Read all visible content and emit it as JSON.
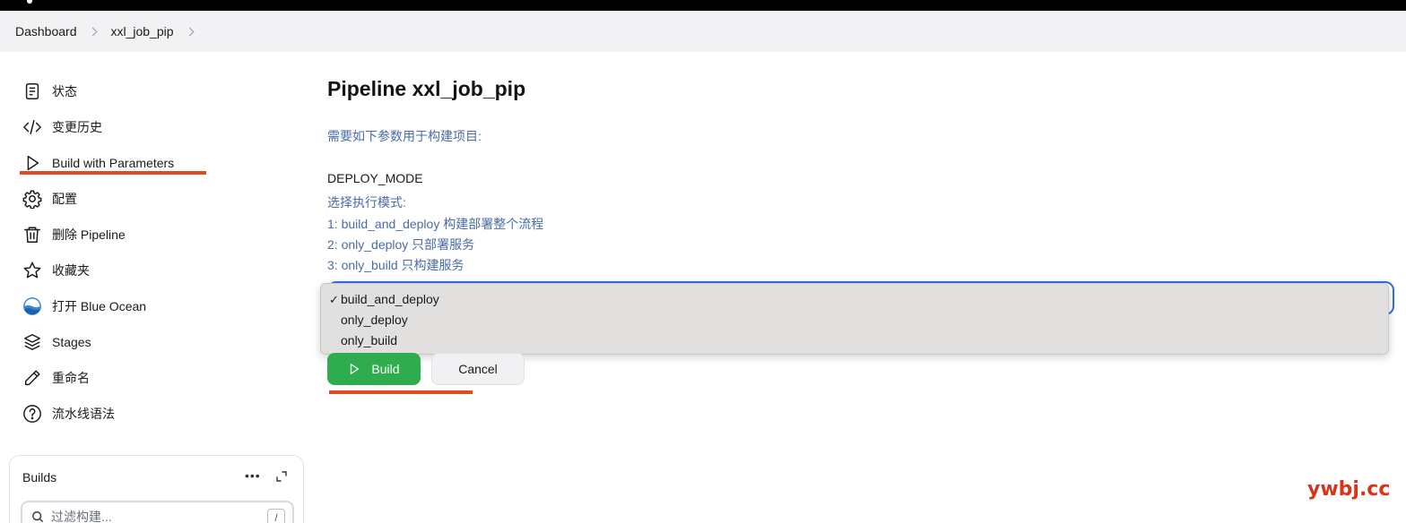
{
  "breadcrumb": {
    "items": [
      "Dashboard",
      "xxl_job_pip"
    ]
  },
  "sidebar": {
    "items": [
      {
        "label": "状态",
        "icon": "document-icon"
      },
      {
        "label": "变更历史",
        "icon": "code-icon"
      },
      {
        "label": "Build with Parameters",
        "icon": "play-icon"
      },
      {
        "label": "配置",
        "icon": "gear-icon"
      },
      {
        "label": "删除 Pipeline",
        "icon": "trash-icon"
      },
      {
        "label": "收藏夹",
        "icon": "star-icon"
      },
      {
        "label": "打开 Blue Ocean",
        "icon": "blue-ocean-icon"
      },
      {
        "label": "Stages",
        "icon": "layers-icon"
      },
      {
        "label": "重命名",
        "icon": "pencil-icon"
      },
      {
        "label": "流水线语法",
        "icon": "help-icon"
      }
    ],
    "builds": {
      "title": "Builds",
      "filter_placeholder": "过滤构建...",
      "shortcut": "/"
    }
  },
  "main": {
    "title": "Pipeline xxl_job_pip",
    "description": "需要如下参数用于构建项目:",
    "parameter": {
      "name": "DEPLOY_MODE",
      "description_lines": [
        "选择执行模式:",
        "1: build_and_deploy 构建部署整个流程",
        "2: only_deploy 只部署服务",
        "3: only_build  只构建服务"
      ],
      "options": [
        "build_and_deploy",
        "only_deploy",
        "only_build"
      ],
      "selected": "build_and_deploy",
      "check_mark": "✓"
    },
    "build_label": "Build",
    "cancel_label": "Cancel"
  },
  "watermark": "ywbj.cc",
  "colors": {
    "annotation": "#e04a1f",
    "build_green": "#2eac4e",
    "link_blue": "#4a6ca8",
    "focus_blue": "#2f6fdc"
  }
}
